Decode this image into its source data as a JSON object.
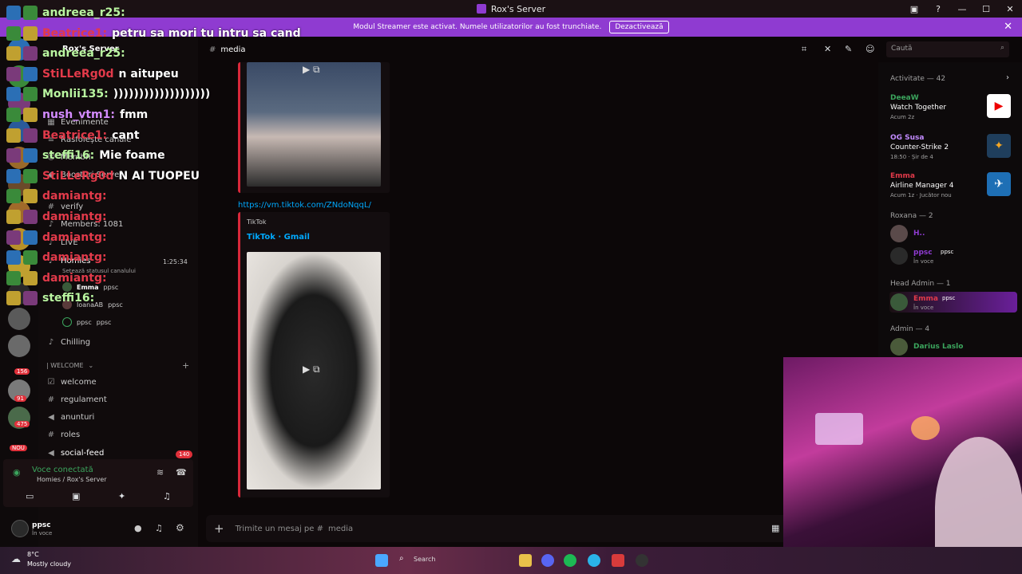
{
  "titlebar": {
    "title": "Rox's Server"
  },
  "banner": {
    "message": "Modul Streamer este activat. Numele utilizatorilor au fost trunchiate.",
    "button": "Dezactivează"
  },
  "rail": {
    "badges": [
      "156",
      "91",
      "475"
    ],
    "new_label": "NOU"
  },
  "sidebar": {
    "server_name": "Rox's Server",
    "items": [
      {
        "label": "Evenimente"
      },
      {
        "label": "Răsfoiește canale"
      },
      {
        "label": "Membri"
      },
      {
        "label": "Boosturi Server"
      }
    ],
    "channels_top": [
      {
        "label": "verify"
      },
      {
        "label": "Members: 1081"
      },
      {
        "label": "LIVE"
      }
    ],
    "voice_channel": {
      "label": "Homies",
      "timer": "1:25:34",
      "status": "Setează statusul canalului"
    },
    "voice_users": [
      {
        "name": "Emma",
        "tag": "ppsc"
      },
      {
        "name": "IoanaAB",
        "tag": "ppsc"
      },
      {
        "name": "ppsc",
        "tag": "ppsc"
      }
    ],
    "chilling": "Chilling",
    "category": "| WELCOME",
    "channels": [
      {
        "label": "welcome"
      },
      {
        "label": "regulament"
      },
      {
        "label": "anunturi"
      },
      {
        "label": "roles"
      },
      {
        "label": "social-feed",
        "badge": "140"
      }
    ]
  },
  "voice_panel": {
    "status": "Voce conectată",
    "location": "Homies / Rox's Server"
  },
  "user_panel": {
    "name": "ppsc",
    "status": "În voce"
  },
  "main": {
    "channel": "media",
    "search_placeholder": "Caută",
    "link": "https://vm.tiktok.com/ZNdoNqqL/",
    "embed_provider": "TikTok",
    "embed_title": "TikTok · Gmail",
    "composer_placeholder": "Trimite un mesaj pe #",
    "composer_channel": "media"
  },
  "members": {
    "activity_header": "Activitate — 42",
    "activities": [
      {
        "user": "DeeaW",
        "game": "Watch Together",
        "detail": "Acum 2z"
      },
      {
        "user": "OG Susa",
        "game": "Counter-Strike 2",
        "detail": "18:50 · Șir de 4"
      },
      {
        "user": "Emma",
        "game": "Airline Manager 4",
        "detail": "Acum 1z · Jucător nou"
      }
    ],
    "groups": [
      {
        "name": "Roxana — 2",
        "members": [
          {
            "name": "H..",
            "tag": ""
          },
          {
            "name": "ppsc",
            "tag": "ppsc",
            "status": "În voce"
          }
        ]
      },
      {
        "name": "Head Admin — 1",
        "members": [
          {
            "name": "Emma",
            "tag": "ppsc",
            "status": "În voce"
          }
        ]
      },
      {
        "name": "Admin — 4",
        "members": [
          {
            "name": "Darius Laslo",
            "tag": ""
          }
        ]
      }
    ]
  },
  "chat_overlay": [
    {
      "user": "andreea_r25:",
      "msg": "",
      "color": "#b9f5a0"
    },
    {
      "user": "Beatrice1:",
      "msg": "petru sa mori tu intru sa cand",
      "color": "#e23a4a"
    },
    {
      "user": "andreea_r25:",
      "msg": "",
      "color": "#b9f5a0"
    },
    {
      "user": "StiLLeRg0d",
      "msg": "n aitupeu",
      "color": "#e23a4a"
    },
    {
      "user": "Monlii135:",
      "msg": ")))))))))))))))))))",
      "color": "#b9f5a0"
    },
    {
      "user": "nush_vtm1:",
      "msg": "fmm",
      "color": "#d38bff"
    },
    {
      "user": "Beatrice1:",
      "msg": "cant",
      "color": "#e23a4a"
    },
    {
      "user": "steffi16:",
      "msg": "Mie foame",
      "color": "#b9f5a0"
    },
    {
      "user": "StiLLeRg0d",
      "msg": "N AI TUOPEU",
      "color": "#e23a4a"
    },
    {
      "user": "damiantg:",
      "msg": "",
      "color": "#e23a4a"
    },
    {
      "user": "damiantg:",
      "msg": "",
      "color": "#e23a4a"
    },
    {
      "user": "damiantg:",
      "msg": "",
      "color": "#e23a4a"
    },
    {
      "user": "damiantg:",
      "msg": "",
      "color": "#e23a4a"
    },
    {
      "user": "damiantg:",
      "msg": "",
      "color": "#e23a4a"
    },
    {
      "user": "steffi16:",
      "msg": "",
      "color": "#b9f5a0"
    }
  ],
  "taskbar": {
    "weather_temp": "8°C",
    "weather_desc": "Mostly cloudy",
    "search": "Search"
  }
}
